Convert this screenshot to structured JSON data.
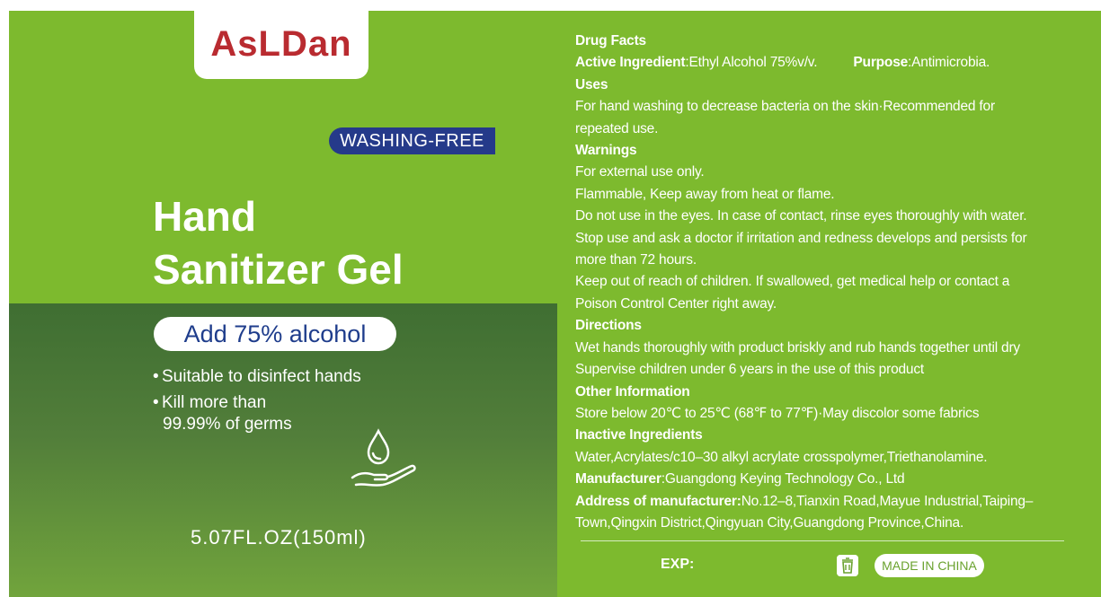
{
  "brand": "AsLDan",
  "badge": "WASHING-FREE",
  "title_line1": "Hand",
  "title_line2": "Sanitizer Gel",
  "alcohol": "Add 75% alcohol",
  "bullets": {
    "b1": "Suitable to disinfect hands",
    "b2a": "Kill more than",
    "b2b": "99.99% of germs",
    "dot": "•"
  },
  "volume": "5.07FL.OZ(150ml)",
  "facts": {
    "heading": "Drug Facts",
    "active_label": "Active Ingredient",
    "active_value": ":Ethyl Alcohol 75%v/v.",
    "purpose_label": "Purpose",
    "purpose_value": ":Antimicrobia.",
    "uses_heading": "Uses",
    "uses_1": "For hand washing to decrease bacteria on the skin·Recommended for",
    "uses_2": "repeated use.",
    "warnings_heading": "Warnings",
    "warn_1": "For external use only.",
    "warn_2": "Flammable, Keep away from heat or flame.",
    "warn_3": "Do not use in the eyes. In case of contact, rinse eyes thoroughly with water.",
    "warn_4": "Stop use and ask a doctor if irritation and redness develops and persists for",
    "warn_5": "more than 72 hours.",
    "warn_6": "Keep out of reach of children. If swallowed, get medical help or contact a",
    "warn_7": "Poison Control Center right away.",
    "directions_heading": "Directions",
    "dir_1": "Wet hands thoroughly with product briskly and rub hands together until dry",
    "dir_2": "Supervise children under 6 years in the use of this product",
    "other_heading": "Other Information",
    "other_1": "Store below 20℃ to 25℃ (68℉ to 77℉)·May discolor some fabrics",
    "inactive_heading": "Inactive Ingredients",
    "inactive_1": "Water,Acrylates/c10–30 alkyl acrylate crosspolymer,Triethanolamine.",
    "manufacturer_label": "Manufacturer",
    "manufacturer_value": ":Guangdong Keying Technology Co., Ltd",
    "address_label": "Address of manufacturer:",
    "address_value_1": "No.12–8,Tianxin Road,Mayue Industrial,Taiping–",
    "address_value_2": "Town,Qingxin District,Qingyuan City,Guangdong Province,China."
  },
  "footer": {
    "exp": "EXP:",
    "made_in": "MADE IN CHINA"
  },
  "icons": [
    "droplet-hand-icon",
    "recycle-bin-icon"
  ],
  "colors": {
    "label_green": "#7dba2e",
    "dark_green": "#3f6e32",
    "brand_red": "#b92b30",
    "badge_blue": "#253a8a",
    "pill_text_blue": "#1f3d8c"
  }
}
